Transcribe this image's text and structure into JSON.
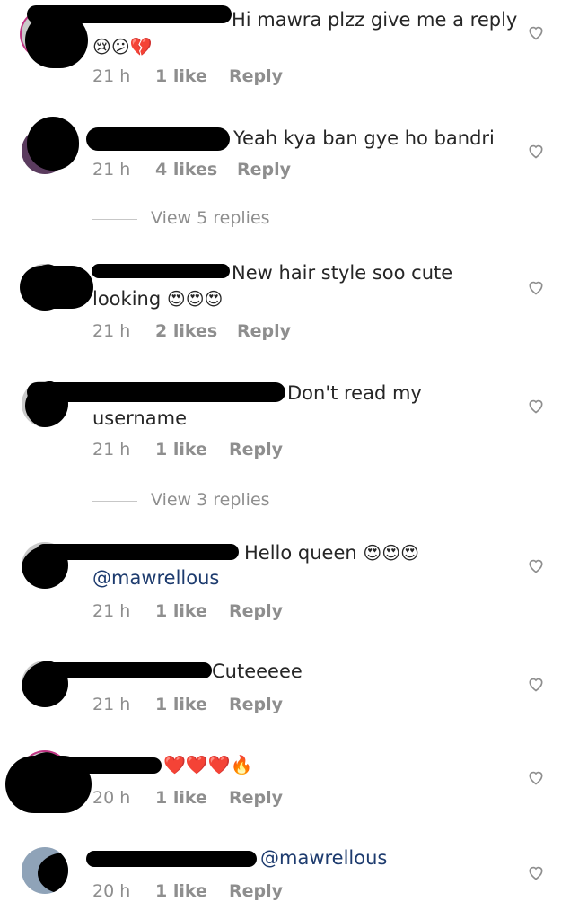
{
  "comments": [
    {
      "text": "Hi mawra plzz give me a reply",
      "emojis": "😢😕💔",
      "time": "21 h",
      "likes": "1 like",
      "reply": "Reply"
    },
    {
      "text": "Yeah kya ban gye ho bandri",
      "time": "21 h",
      "likes": "4 likes",
      "reply": "Reply",
      "view_replies": "View 5 replies"
    },
    {
      "text": "New hair style soo cute",
      "text2": "looking",
      "emojis": "😍😍😍",
      "time": "21 h",
      "likes": "2 likes",
      "reply": "Reply"
    },
    {
      "text": "Don't read my",
      "text2": "username",
      "time": "21 h",
      "likes": "1 like",
      "reply": "Reply",
      "view_replies": "View 3 replies"
    },
    {
      "text": "Hello queen",
      "emojis": "😍😍😍",
      "mention": "@mawrellous",
      "time": "21 h",
      "likes": "1 like",
      "reply": "Reply"
    },
    {
      "text": "Cuteeeee",
      "time": "21 h",
      "likes": "1 like",
      "reply": "Reply"
    },
    {
      "emojis": "❤️❤️❤️🔥",
      "time": "20 h",
      "likes": "1 like",
      "reply": "Reply"
    },
    {
      "mention": "@mawrellous",
      "time": "20 h",
      "likes": "1 like",
      "reply": "Reply"
    }
  ],
  "colors": {
    "text": "#262626",
    "meta": "#8e8e8e",
    "mention": "#1d3b6e",
    "story_ring": "#c13584"
  }
}
